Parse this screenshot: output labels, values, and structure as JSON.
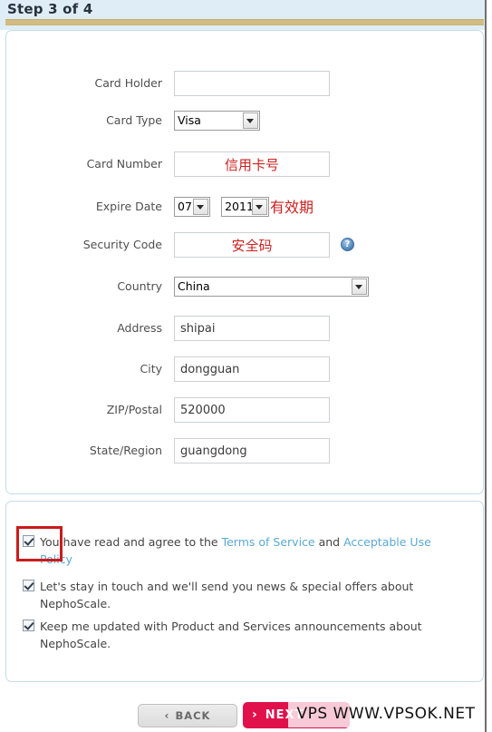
{
  "header": {
    "title": "Step 3 of 4"
  },
  "form": {
    "rows": [
      {
        "label": "Card Holder",
        "type": "text",
        "value": ""
      },
      {
        "label": "Card Type",
        "type": "select",
        "value": "Visa"
      },
      {
        "label": "Card Number",
        "type": "text",
        "value": "信用卡号"
      },
      {
        "label": "Expire Date",
        "type": "date",
        "month": "07",
        "year": "2011",
        "note": "有效期"
      },
      {
        "label": "Security Code",
        "type": "text",
        "value": "安全码",
        "help": "?"
      },
      {
        "label": "Country",
        "type": "select",
        "value": "China"
      },
      {
        "label": "Address",
        "type": "text",
        "value": "shipai"
      },
      {
        "label": "City",
        "type": "text",
        "value": "dongguan"
      },
      {
        "label": "ZIP/Postal",
        "type": "text",
        "value": "520000"
      },
      {
        "label": "State/Region",
        "type": "text",
        "value": "guangdong"
      }
    ]
  },
  "terms": {
    "agree": {
      "prefix": "You have read and agree to the ",
      "link1": "Terms of Service",
      "middle": " and ",
      "link2": "Acceptable Use Policy",
      "suffix": ""
    },
    "newsletter": "Let's stay in touch and we'll send you news & special offers about NephoScale.",
    "product_updates": "Keep me updated with Product and Services announcements about NephoScale."
  },
  "footer": {
    "back_chevron": "‹",
    "back_label": "BACK",
    "next_chevron": "›",
    "next_label": "NEXT"
  },
  "watermark": {
    "text": "VPS WWW.VPSOK.NET"
  },
  "colors": {
    "header_bg": "#dfeef6",
    "gold_rule": "#d3bc82",
    "panel_border": "#c5dce7",
    "link": "#5aa9d6",
    "annotation_red": "#cc1b1b",
    "cn_text_red": "#cc2222",
    "next_button": "#e0114b"
  }
}
